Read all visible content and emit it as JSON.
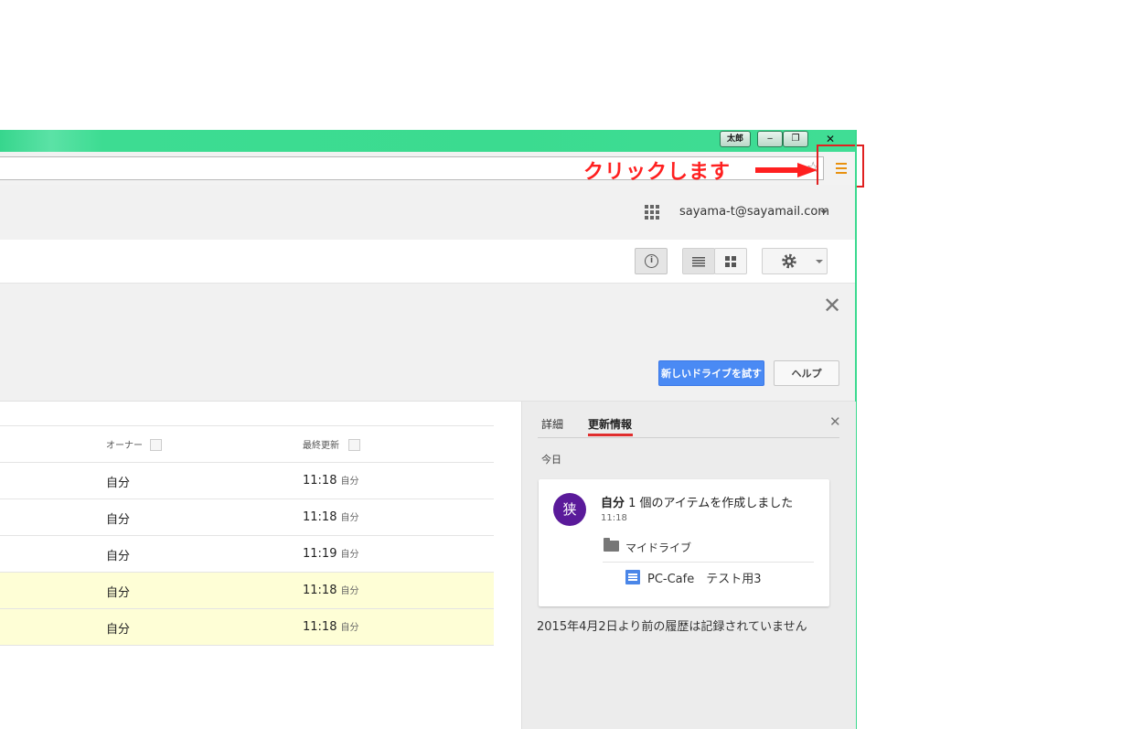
{
  "window": {
    "user_badge": "太郎",
    "minimize": "‒",
    "maximize": "❐",
    "close": "✕"
  },
  "annotation": {
    "text": "クリックします",
    "color": "#ff2020"
  },
  "header": {
    "account_email": "sayama-t@sayamail.com"
  },
  "banner": {
    "try_new_button": "新しいドライブを試す",
    "help_button": "ヘルプ",
    "close": "✕"
  },
  "file_list": {
    "columns": [
      "オーナー",
      "最終更新"
    ],
    "rows": [
      {
        "owner": "自分",
        "time": "11:18",
        "by": "自分",
        "selected": false
      },
      {
        "owner": "自分",
        "time": "11:18",
        "by": "自分",
        "selected": false
      },
      {
        "owner": "自分",
        "time": "11:19",
        "by": "自分",
        "selected": false
      },
      {
        "owner": "自分",
        "time": "11:18",
        "by": "自分",
        "selected": true
      },
      {
        "owner": "自分",
        "time": "11:18",
        "by": "自分",
        "selected": true
      }
    ]
  },
  "panel": {
    "tabs": [
      "詳細",
      "更新情報"
    ],
    "active_tab": "更新情報",
    "close": "✕",
    "section_label": "今日",
    "activity": {
      "avatar_letter": "狭",
      "actor": "自分",
      "action": " 1 個のアイテムを作成しました",
      "time": "11:18",
      "folder": "マイドライブ",
      "document": "PC-Cafe　テスト用3"
    },
    "history_note": "2015年4月2日より前の履歴は記録されていません"
  },
  "colors": {
    "titlebar": "#3ddc92",
    "primary_button": "#4a8af4",
    "active_tab_underline": "#e02d2d",
    "avatar": "#5a1a9a",
    "selected_row": "#fefed6",
    "menu_icon": "#e8910f"
  }
}
